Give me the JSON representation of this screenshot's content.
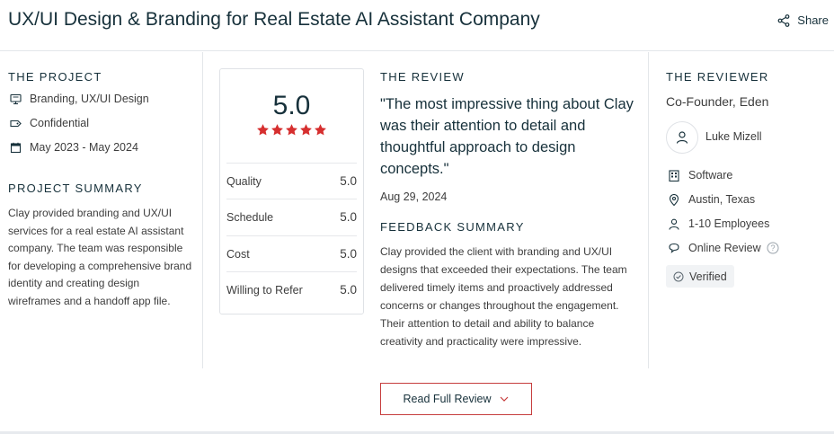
{
  "header": {
    "title": "UX/UI Design & Branding for Real Estate AI Assistant Company",
    "share_label": "Share"
  },
  "project": {
    "heading": "THE PROJECT",
    "service": "Branding, UX/UI Design",
    "budget": "Confidential",
    "dates": "May 2023 - May 2024",
    "summary_heading": "PROJECT SUMMARY",
    "summary": "Clay provided branding and UX/UI services for a real estate AI assistant company. The team was responsible for developing a comprehensive brand identity and creating design wireframes and a handoff app file."
  },
  "rating": {
    "overall": "5.0",
    "stars": 5,
    "star_color": "#d62f2f",
    "scores": [
      {
        "label": "Quality",
        "value": "5.0"
      },
      {
        "label": "Schedule",
        "value": "5.0"
      },
      {
        "label": "Cost",
        "value": "5.0"
      },
      {
        "label": "Willing to Refer",
        "value": "5.0"
      }
    ]
  },
  "review": {
    "heading": "THE REVIEW",
    "quote": "\"The most impressive thing about Clay was their attention to detail and thoughtful approach to design concepts.\"",
    "date": "Aug 29, 2024",
    "feedback_heading": "FEEDBACK SUMMARY",
    "feedback": "Clay provided the client with branding and UX/UI designs that exceeded their expectations. The team delivered timely items and proactively addressed concerns or changes throughout the engagement. Their attention to detail and ability to balance creativity and practicality were impressive.",
    "read_full_label": "Read Full Review"
  },
  "reviewer": {
    "heading": "THE REVIEWER",
    "role": "Co-Founder, Eden",
    "name": "Luke Mizell",
    "industry": "Software",
    "location": "Austin, Texas",
    "company_size": "1-10 Employees",
    "review_type": "Online Review",
    "verified_label": "Verified"
  },
  "colors": {
    "accent": "#c63d3d",
    "heading": "#17313b",
    "text": "#3d3d3d"
  }
}
